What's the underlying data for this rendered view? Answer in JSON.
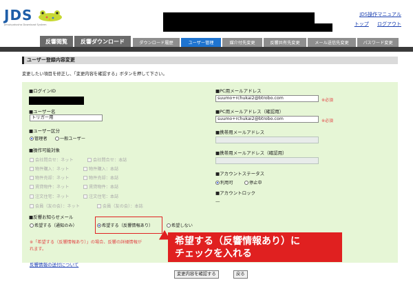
{
  "header": {
    "logo_text": "JDS",
    "logo_sub": "Jimukyokusha Download System",
    "links": {
      "manual": "JDS操作マニュアル",
      "top": "トップ",
      "logout": "ログアウト"
    }
  },
  "tabs": {
    "main": [
      "反響閲覧",
      "反響ダウンロード"
    ],
    "sub": [
      "ダウンロード履歴",
      "ユーザー管理",
      "媒介付先変更",
      "反響共有先変更",
      "メール送信先変更",
      "パスワード変更"
    ],
    "active_sub": "ユーザー管理"
  },
  "page": {
    "title": "ユーザー登録内容変更",
    "instruction": "変更したい項目を修正し、「変更内容を確認する」ボタンを押して下さい。"
  },
  "form": {
    "login_id_label": "■ログインID",
    "username_label": "■ユーザー名",
    "username_value": "トリガー用",
    "user_type_label": "■ユーザー区分",
    "user_type_options": [
      "管理者",
      "一般ユーザー"
    ],
    "user_type_selected": "管理者",
    "operation_label": "■操作可能対象",
    "operation_options": [
      [
        "会社問合せ：ネット",
        "会社問合せ：本誌"
      ],
      [
        "物件購入：ネット",
        "物件購入：本誌"
      ],
      [
        "物件売却：ネット",
        "物件売却：本誌"
      ],
      [
        "賃貸物件：ネット",
        "賃貸物件：本誌"
      ],
      [
        "注文住宅：ネット",
        "注文住宅：本誌"
      ],
      [
        "会員（友の会）：ネット",
        "会員（友の会）：本誌"
      ]
    ],
    "notify_label": "■反響お知らせメール",
    "notify_options": [
      "希望する（通知のみ）",
      "希望する（反響情報あり）",
      "希望しない"
    ],
    "notify_selected": "希望する（反響情報あり）",
    "note_line1": "※「希望する（反響情報あり）」の場合、反響の詳細情報が",
    "note_line2": "れます。",
    "pc_mail_label": "■PC用メールアドレス",
    "pc_mail_value": "suumo+rchukai2@btrobo.com",
    "pc_mail_confirm_label": "■PC用メールアドレス（確認用）",
    "pc_mail_confirm_value": "suumo+rchukai2@btrobo.com",
    "required_mark": "※必須",
    "mobile_mail_label": "■携帯用メールアドレス",
    "mobile_mail_confirm_label": "■携帯用メールアドレス（確認用）",
    "account_status_label": "■アカウントステータス",
    "account_status_options": [
      "利用可",
      "停止中"
    ],
    "account_status_selected": "利用可",
    "account_lock_label": "■アカウントロック",
    "account_lock_value": "—",
    "link_bottom": "反響情報の送付について",
    "confirm_button": "変更内容を確認する",
    "back_button": "戻る"
  },
  "callout": {
    "line1": "希望する（反響情報あり）に",
    "line2": "チェックを入れる"
  }
}
